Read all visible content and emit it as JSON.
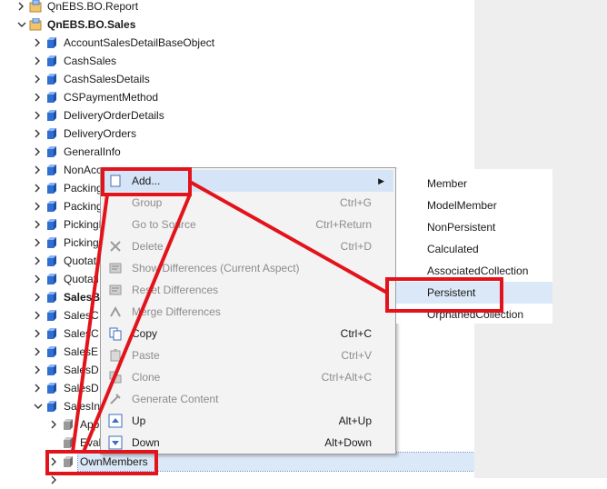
{
  "tree": {
    "items": [
      {
        "label": "QnEBS.BO.Report",
        "expanded": false,
        "bold": false
      },
      {
        "label": "QnEBS.BO.Sales",
        "expanded": true,
        "bold": true
      },
      {
        "label": "AccountSalesDetailBaseObject",
        "expanded": false
      },
      {
        "label": "CashSales",
        "expanded": false
      },
      {
        "label": "CashSalesDetails",
        "expanded": false
      },
      {
        "label": "CSPaymentMethod",
        "expanded": false
      },
      {
        "label": "DeliveryOrderDetails",
        "expanded": false
      },
      {
        "label": "DeliveryOrders",
        "expanded": false
      },
      {
        "label": "GeneralInfo",
        "expanded": false
      },
      {
        "label": "NonAcc",
        "expanded": false
      },
      {
        "label": "PackingL",
        "expanded": false
      },
      {
        "label": "PackingL",
        "expanded": false
      },
      {
        "label": "PickingLi",
        "expanded": false
      },
      {
        "label": "PickingLi",
        "expanded": false
      },
      {
        "label": "Quotati",
        "expanded": false
      },
      {
        "label": "Quotati",
        "expanded": false
      },
      {
        "label": "SalesB",
        "expanded": false,
        "bold": true
      },
      {
        "label": "SalesC",
        "expanded": false
      },
      {
        "label": "SalesC",
        "expanded": false
      },
      {
        "label": "SalesE",
        "expanded": false
      },
      {
        "label": "SalesD",
        "expanded": false
      },
      {
        "label": "SalesD",
        "expanded": false
      },
      {
        "label": "SalesInv",
        "expanded": true
      },
      {
        "label": "Appe",
        "expanded": false
      },
      {
        "label": "Evalu",
        "expanded": null
      },
      {
        "label": "OwnMembers",
        "expanded": false,
        "selected": true
      }
    ]
  },
  "context_menu": {
    "items": [
      {
        "label": "Add...",
        "shortcut": "",
        "enabled": true,
        "highlighted": true,
        "has_submenu": true,
        "icon": "add-icon"
      },
      {
        "label": "Group",
        "shortcut": "Ctrl+G",
        "enabled": false,
        "icon": ""
      },
      {
        "label": "Go to Source",
        "shortcut": "Ctrl+Return",
        "enabled": false,
        "icon": ""
      },
      {
        "label": "Delete",
        "shortcut": "Ctrl+D",
        "enabled": false,
        "icon": "delete-icon"
      },
      {
        "label": "Show Differences (Current Aspect)",
        "shortcut": "",
        "enabled": false,
        "icon": "diff-icon"
      },
      {
        "label": "Reset Differences",
        "shortcut": "",
        "enabled": false,
        "icon": "reset-icon"
      },
      {
        "label": "Merge Differences",
        "shortcut": "",
        "enabled": false,
        "icon": "merge-icon"
      },
      {
        "label": "Copy",
        "shortcut": "Ctrl+C",
        "enabled": true,
        "icon": "copy-icon"
      },
      {
        "label": "Paste",
        "shortcut": "Ctrl+V",
        "enabled": false,
        "icon": "paste-icon"
      },
      {
        "label": "Clone",
        "shortcut": "Ctrl+Alt+C",
        "enabled": false,
        "icon": "clone-icon"
      },
      {
        "label": "Generate Content",
        "shortcut": "",
        "enabled": false,
        "icon": "generate-icon"
      },
      {
        "label": "Up",
        "shortcut": "Alt+Up",
        "enabled": true,
        "icon": "up-icon"
      },
      {
        "label": "Down",
        "shortcut": "Alt+Down",
        "enabled": true,
        "icon": "down-icon"
      }
    ]
  },
  "submenu": {
    "items": [
      {
        "label": "Member",
        "highlighted": false
      },
      {
        "label": "ModelMember",
        "highlighted": false
      },
      {
        "label": "NonPersistent",
        "highlighted": false
      },
      {
        "label": "Calculated",
        "highlighted": false
      },
      {
        "label": "AssociatedCollection",
        "highlighted": false
      },
      {
        "label": "Persistent",
        "highlighted": true
      },
      {
        "label": "OrphanedCollection",
        "highlighted": false
      }
    ]
  },
  "colors": {
    "annotation": "#e3131b",
    "cube_blue": "#2f6fd1",
    "cube_gray": "#8f8f8f",
    "highlight": "#d5e5f7"
  }
}
